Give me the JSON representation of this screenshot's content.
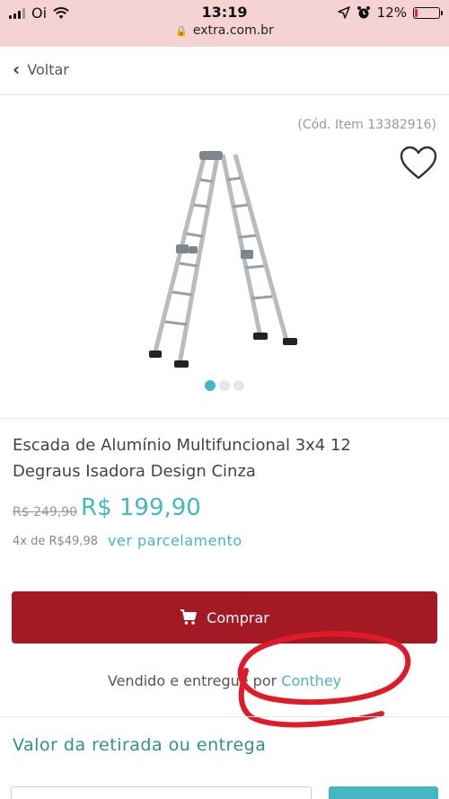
{
  "status_bar": {
    "carrier": "Oi",
    "time": "13:19",
    "url": "extra.com.br",
    "battery": "12%",
    "battery_level": 0.12
  },
  "nav": {
    "back_label": "Voltar"
  },
  "product": {
    "code": "(Cód. Item 13382916)",
    "title": "Escada de Alumínio Multifuncional 3x4 12 Degraus Isadora Design Cinza",
    "old_price": "R$ 249,90",
    "price": "R$ 199,90",
    "installments": "4x de R$49,98",
    "installments_link": "ver parcelamento",
    "image_count": 3,
    "active_image": 1
  },
  "actions": {
    "buy_label": "Comprar"
  },
  "seller": {
    "prefix": "Vendido e entregue por",
    "name": "Conthey"
  },
  "delivery": {
    "section_title": "Valor da retirada ou entrega"
  },
  "colors": {
    "accent": "#45b7c1",
    "buy_button": "#a31a24",
    "status_bar_bg": "#f6d3d3",
    "annotation": "#e11a2b"
  }
}
